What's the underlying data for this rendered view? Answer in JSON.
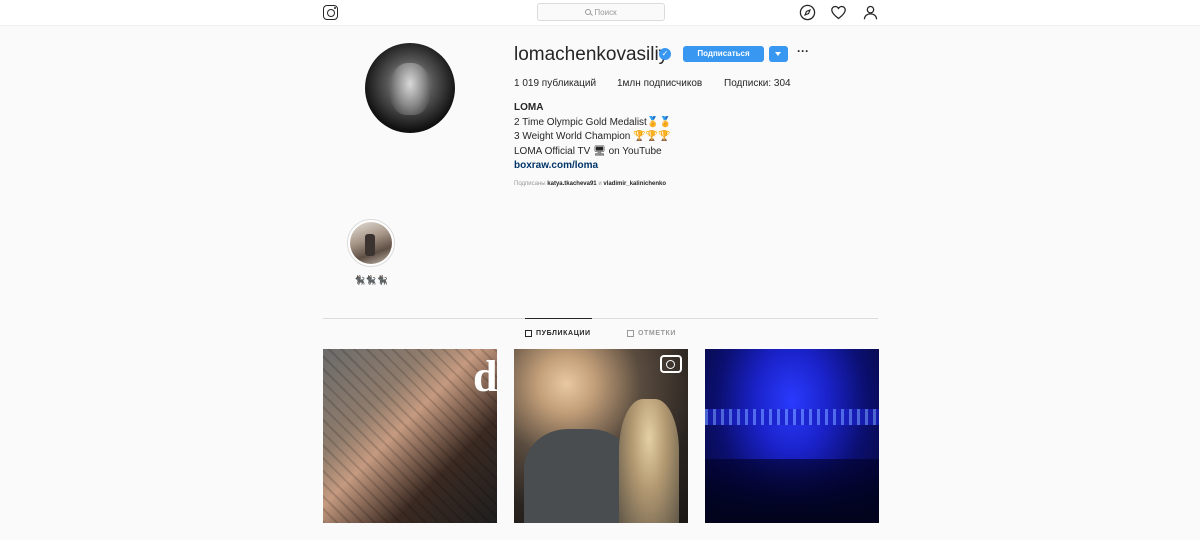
{
  "header": {
    "search_placeholder": "Поиск",
    "logo_icon": "instagram-camera-icon",
    "nav_icons": [
      "compass-explore-icon",
      "heart-activity-icon",
      "person-profile-icon"
    ]
  },
  "profile": {
    "username": "lomachenkovasiliy",
    "verified_mark": "✓",
    "follow_button": "Подписаться",
    "more_glyph": "···",
    "stats": {
      "posts": "1 019 публикаций",
      "followers": "1млн подписчиков",
      "following": "Подписки: 304"
    },
    "bio": {
      "name": "LOMA",
      "line1": "2 Time Olympic Gold Medalist🏅🏅",
      "line2": "3 Weight World Champion 🏆🏆🏆",
      "line3": "LOMA Official TV 🖥 on YouTube",
      "link": "boxraw.com/loma"
    },
    "followed_by_prefix": "Подписаны",
    "followed_by_user1": "katya.tkacheva91",
    "followed_by_and": "и",
    "followed_by_user2": "vladimir_kalinichenko"
  },
  "highlights": [
    {
      "label": "🐈‍⬛🐈‍⬛🐈‍⬛"
    }
  ],
  "tabs": {
    "posts": "ПУБЛИКАЦИИ",
    "tagged": "ОТМЕТКИ"
  },
  "colors": {
    "accent": "#3897f0",
    "link": "#003569",
    "muted": "#999999"
  }
}
